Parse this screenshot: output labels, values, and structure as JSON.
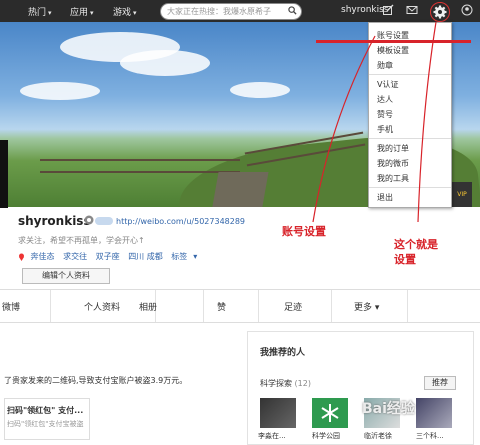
{
  "topbar": {
    "nav": [
      {
        "label": "热门"
      },
      {
        "label": "应用"
      },
      {
        "label": "游戏"
      }
    ],
    "search_placeholder": "大家正在热搜：我爆水原希子",
    "username": "shyronkiss"
  },
  "settings_menu": {
    "items": [
      "账号设置",
      "模板设置",
      "勋章",
      "V认证",
      "达人",
      "赞号",
      "手机",
      "我的订单",
      "我的微币",
      "我的工具",
      "退出"
    ]
  },
  "profile": {
    "name": "shyronkiss",
    "url": "http://weibo.com/u/5027348289",
    "slogan": "求关注，希望不再孤单，学会开心↑",
    "tags": [
      "奔佳态",
      "求交往",
      "双子座",
      "四川 成都",
      "标签"
    ],
    "edit_label": "编辑个人资料"
  },
  "tabs": [
    "微博",
    "个人资料",
    "相册",
    "赞",
    "足迹",
    "更多"
  ],
  "feed": {
    "text": "了贵家发来的二维码,导致支付宝账户被盗3.9万元。",
    "card_title": "扫码\"领红包\" 支付...",
    "card_sub": "扫码\"领红包\"支付宝被盗"
  },
  "recommend": {
    "title": "我推荐的人",
    "category": "科学探索",
    "count": "(12)",
    "button": "推荐",
    "people": [
      "李淼在...",
      "科学公园",
      "临沂老徐",
      "三个科..."
    ]
  },
  "annotations": {
    "account_settings": "账号设置",
    "this_is": "这个就是",
    "settings": "设置"
  },
  "watermark": "Bai经验",
  "vip_badge": "VIP",
  "colors": {
    "topbar": "#2b2b2b",
    "annotation": "#d8232a",
    "link": "#3366aa"
  }
}
